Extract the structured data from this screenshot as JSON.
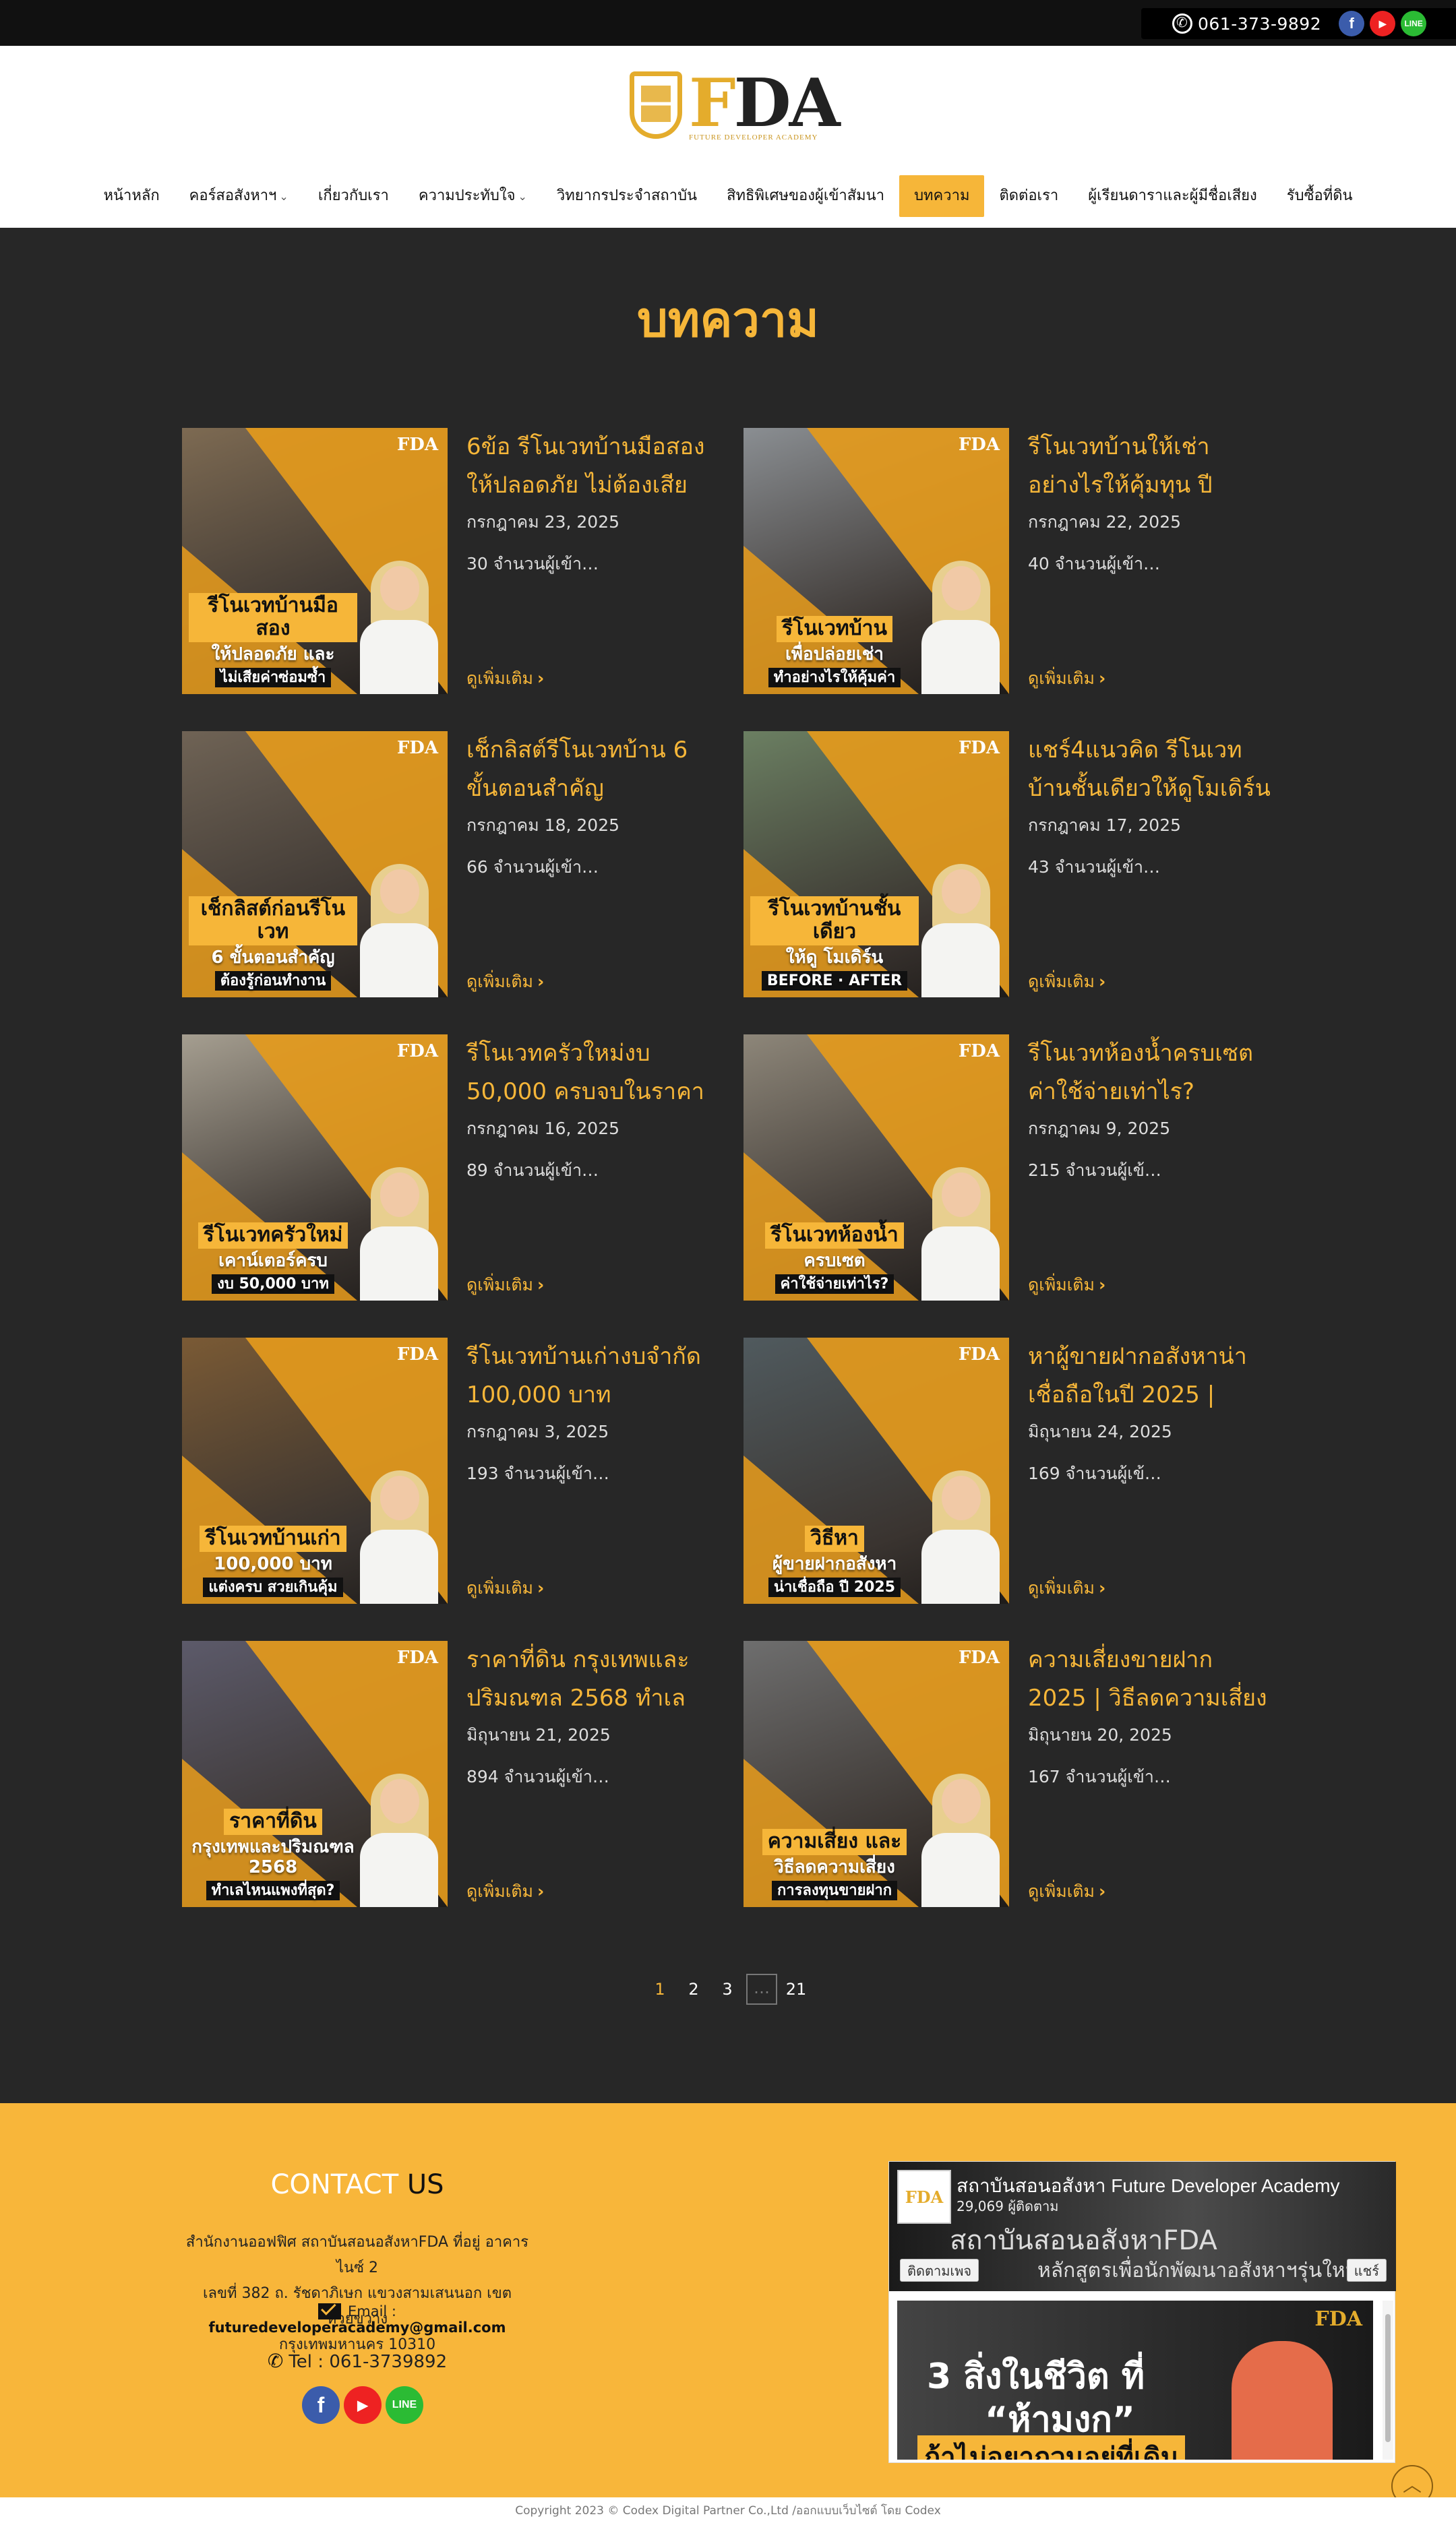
{
  "topbar": {
    "phone": "061-373-9892",
    "social": [
      {
        "icon": "facebook-icon",
        "glyph": "f"
      },
      {
        "icon": "youtube-icon",
        "glyph": "▶"
      },
      {
        "icon": "line-icon",
        "glyph": "LINE"
      }
    ]
  },
  "brand": {
    "logo_letter_f": "F",
    "logo_letters_da": "DA",
    "logo_tagline": "FUTURE DEVELOPER ACADEMY",
    "accent": "#f6b639",
    "dark": "#272727"
  },
  "nav": [
    {
      "label": "หน้าหลัก",
      "caret": false,
      "active": false
    },
    {
      "label": "คอร์สอสังหาฯ",
      "caret": true,
      "active": false
    },
    {
      "label": "เกี่ยวกับเรา",
      "caret": false,
      "active": false
    },
    {
      "label": "ความประทับใจ",
      "caret": true,
      "active": false
    },
    {
      "label": "วิทยากรประจำสถาบัน",
      "caret": false,
      "active": false
    },
    {
      "label": "สิทธิพิเศษของผู้เข้าสัมนา",
      "caret": false,
      "active": false
    },
    {
      "label": "บทความ",
      "caret": false,
      "active": true
    },
    {
      "label": "ติดต่อเรา",
      "caret": false,
      "active": false
    },
    {
      "label": "ผู้เรียนดาราและผู้มีชื่อเสียง",
      "caret": false,
      "active": false
    },
    {
      "label": "รับซื้อที่ดิน",
      "caret": false,
      "active": false
    }
  ],
  "page_title": "บทความ",
  "read_more": "ดูเพิ่มเติม",
  "posts": [
    {
      "title": "6ข้อ รีโนเวทบ้านมือสอง ให้ปลอดภัย ไม่ต้องเสีย",
      "date": "กรกฎาคม 23, 2025",
      "views": "30 จำนวนผู้เข้า…",
      "thumb": {
        "cap1": "รีโนเวทบ้านมือสอง",
        "cap2": "ให้ปลอดภัย และ",
        "cap3": "ไม่เสียค่าซ่อมซ้ำ",
        "mini_logo": "FDA",
        "bg": "#7d6a52"
      }
    },
    {
      "title": "รีโนเวทบ้านให้เช่า อย่างไรให้คุ้มทุน ปี",
      "date": "กรกฎาคม 22, 2025",
      "views": "40 จำนวนผู้เข้า…",
      "thumb": {
        "cap1": "รีโนเวทบ้าน",
        "cap2": "เพื่อปล่อยเช่า",
        "cap3": "ทำอย่างไรให้คุ้มค่า",
        "mini_logo": "FDA",
        "bg": "#8a8e92"
      }
    },
    {
      "title": "เช็กลิสต์รีโนเวทบ้าน 6 ขั้นตอนสำคัญ",
      "date": "กรกฎาคม 18, 2025",
      "views": "66 จำนวนผู้เข้า…",
      "thumb": {
        "cap1": "เช็กลิสต์ก่อนรีโนเวท",
        "cap2": "6 ขั้นตอนสำคัญ",
        "cap3": "ต้องรู้ก่อนทำงาน",
        "mini_logo": "FDA",
        "bg": "#6f6355"
      }
    },
    {
      "title": "แชร์4แนวคิด รีโนเวทบ้านชั้นเดียวให้ดูโมเดิร์น",
      "date": "กรกฎาคม 17, 2025",
      "views": "43 จำนวนผู้เข้า…",
      "thumb": {
        "cap1": "รีโนเวทบ้านชั้นเดียว",
        "cap2": "ให้ดู โมเดิร์น",
        "cap3": "BEFORE · AFTER",
        "mini_logo": "FDA",
        "bg": "#6b7f62"
      }
    },
    {
      "title": "รีโนเวทครัวใหม่งบ 50,000 ครบจบในราคา",
      "date": "กรกฎาคม 16, 2025",
      "views": "89 จำนวนผู้เข้า…",
      "thumb": {
        "cap1": "รีโนเวทครัวใหม่",
        "cap2": "เคาน์เตอร์ครบ",
        "cap3": "งบ 50,000 บาท",
        "mini_logo": "FDA",
        "bg": "#a59e90"
      }
    },
    {
      "title": "รีโนเวทห้องน้ำครบเซต ค่าใช้จ่ายเท่าไร?",
      "date": "กรกฎาคม 9, 2025",
      "views": "215 จำนวนผู้เข้…",
      "thumb": {
        "cap1": "รีโนเวทห้องน้ำ",
        "cap2": "ครบเซต",
        "cap3": "ค่าใช้จ่ายเท่าไร?",
        "mini_logo": "FDA",
        "bg": "#8d8679"
      }
    },
    {
      "title": "รีโนเวทบ้านเก่างบจำกัด 100,000 บาท",
      "date": "กรกฎาคม 3, 2025",
      "views": "193 จำนวนผู้เข้า…",
      "thumb": {
        "cap1": "รีโนเวทบ้านเก่า",
        "cap2": "100,000 บาท",
        "cap3": "แต่งครบ สวยเกินคุ้ม",
        "mini_logo": "FDA",
        "bg": "#7a5a35"
      }
    },
    {
      "title": "หาผู้ขายฝากอสังหาน่าเชื่อถือในปี 2025 |",
      "date": "มิถุนายน 24, 2025",
      "views": "169 จำนวนผู้เข้…",
      "thumb": {
        "cap1": "วิธีหา",
        "cap2": "ผู้ขายฝากอสังหา",
        "cap3": "น่าเชื่อถือ ปี 2025",
        "mini_logo": "FDA",
        "bg": "#505a5e"
      }
    },
    {
      "title": "ราคาที่ดิน กรุงเทพและปริมณฑล 2568 ทำเล",
      "date": "มิถุนายน 21, 2025",
      "views": "894 จำนวนผู้เข้า…",
      "thumb": {
        "cap1": "ราคาที่ดิน",
        "cap2": "กรุงเทพและปริมณฑล 2568",
        "cap3": "ทำเลไหนแพงที่สุด?",
        "mini_logo": "FDA",
        "bg": "#5c5a6a"
      }
    },
    {
      "title": "ความเสี่ยงขายฝาก 2025 | วิธีลดความเสี่ยง",
      "date": "มิถุนายน 20, 2025",
      "views": "167 จำนวนผู้เข้า…",
      "thumb": {
        "cap1": "ความเสี่ยง และ",
        "cap2": "วิธีลดความเสี่ยง",
        "cap3": "การลงทุนขายฝาก",
        "mini_logo": "FDA",
        "bg": "#6e6e6e"
      }
    }
  ],
  "pagination": {
    "current": "1",
    "pages": [
      "2",
      "3"
    ],
    "dots": "…",
    "last": "21"
  },
  "footer": {
    "contact_title_1": "CONTACT",
    "contact_title_2": "US",
    "address_l1": "สำนักงานออฟฟิศ สถาบันสอนอสังหาFDA ที่อยู่ อาคารไนซ์ 2",
    "address_l2": "เลขที่ 382 ถ. รัชดาภิเษก แขวงสามเสนนอก เขตห้วยขวาง",
    "address_l3": "กรุงเทพมหานคร 10310",
    "email_label": "Email :",
    "email": "futuredeveloperacademy@gmail.com",
    "tel": "Tel : 061-3739892",
    "social": [
      {
        "icon": "facebook-icon",
        "glyph": "f"
      },
      {
        "icon": "youtube-icon",
        "glyph": "▶"
      },
      {
        "icon": "line-icon",
        "glyph": "LINE"
      }
    ],
    "fb_widget": {
      "page_name": "สถาบันสอนอสังหา Future Developer Academy",
      "followers": "29,069 ผู้ติดตาม",
      "banner_l1": "สถาบันสอนอสังหาFDA",
      "banner_l2": "หลักสูตรเพื่อนักพัฒนาอสังหาฯรุ่นใหม่",
      "follow_label": "ติดตามเพจ",
      "share_label": "แชร์",
      "post_l1": "3 สิ่งในชีวิต ที่",
      "post_l2": "“ห้ามงก”",
      "post_l3": "ถ้าไม่อยากวนอยู่ที่เดิม"
    },
    "to_top": "︿"
  },
  "copyright": "Copyright 2023 © Codex Digital Partner Co.,Ltd /ออกแบบเว็บไซต์ โดย Codex"
}
